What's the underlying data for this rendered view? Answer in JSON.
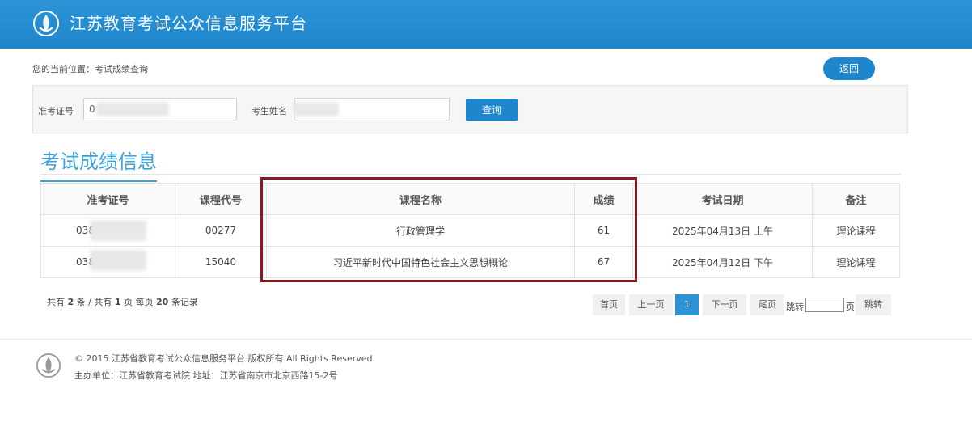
{
  "header": {
    "title": "江苏教育考试公众信息服务平台"
  },
  "breadcrumb": "您的当前位置：考试成绩查询",
  "back_button": "返回",
  "search": {
    "admission_label": "准考证号",
    "admission_value": "0",
    "name_label": "考生姓名",
    "name_value": "",
    "query_button": "查询"
  },
  "section_title": "考试成绩信息",
  "table": {
    "headers": [
      "准考证号",
      "课程代号",
      "课程名称",
      "成绩",
      "考试日期",
      "备注"
    ],
    "rows": [
      [
        "038",
        "00277",
        "行政管理学",
        "61",
        "2025年04月13日 上午",
        "理论课程"
      ],
      [
        "038",
        "15040",
        "习近平新时代中国特色社会主义思想概论",
        "67",
        "2025年04月12日 下午",
        "理论课程"
      ]
    ]
  },
  "summary": {
    "p1": "共有",
    "total": "2",
    "p2": "条 / 共有",
    "pages": "1",
    "p3": "页 每页",
    "per_page": "20",
    "p4": "条记录"
  },
  "pagination": {
    "first": "首页",
    "prev": "上一页",
    "current": "1",
    "next": "下一页",
    "last": "尾页",
    "jump_label": "跳转",
    "page_unit": "页",
    "jump_button": "跳转"
  },
  "footer": {
    "copyright": "© 2015 江苏省教育考试公众信息服务平台 版权所有 All Rights Reserved.",
    "host": "主办单位：江苏省教育考试院 地址：江苏省南京市北京西路15-2号"
  },
  "colors": {
    "brand": "#1f86cc",
    "accent_title": "#3aa2d8",
    "highlight": "#8b1a1a"
  },
  "icons": {
    "logo": "emblem-icon"
  }
}
